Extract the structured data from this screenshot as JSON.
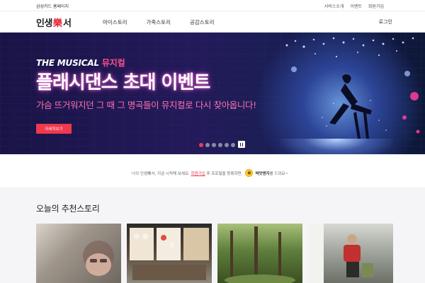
{
  "util_bar": {
    "left": "삼성카드 홈페이지",
    "links": [
      "서비스소개",
      "이벤트",
      "회원가입"
    ]
  },
  "header": {
    "logo_part1": "인생",
    "logo_part2": "樂",
    "logo_part3": "서",
    "nav": [
      "마이스토리",
      "가족스토리",
      "공감스토리"
    ],
    "login": "로그인"
  },
  "hero": {
    "tag_en": "THE MUSICAL",
    "tag_ko": "뮤지컬",
    "title": "플래시댄스 초대 이벤트",
    "subtitle": "가슴 뜨거워지던 그 때 그 명곡들이 뮤지컬로 다시 찾아옵니다!",
    "cta": "자세히보기",
    "slide_count": 6,
    "active_slide": 1
  },
  "notice": {
    "pre": "나의 인생樂서, 지금 시작해 보세요.",
    "link": "회원가입",
    "mid": "후 프로필을 등록하면,",
    "reward": "싹앗엔지",
    "post": "를 드려요~"
  },
  "recommended": {
    "title": "오늘의 추천스토리",
    "cards": [
      {
        "name": "story-card-1"
      },
      {
        "name": "story-card-2"
      },
      {
        "name": "story-card-3"
      },
      {
        "name": "story-card-4"
      }
    ]
  },
  "colors": {
    "accent_red": "#e8384f",
    "hero_bg": "#1e1850",
    "hero_pink": "#ff6fb0"
  }
}
